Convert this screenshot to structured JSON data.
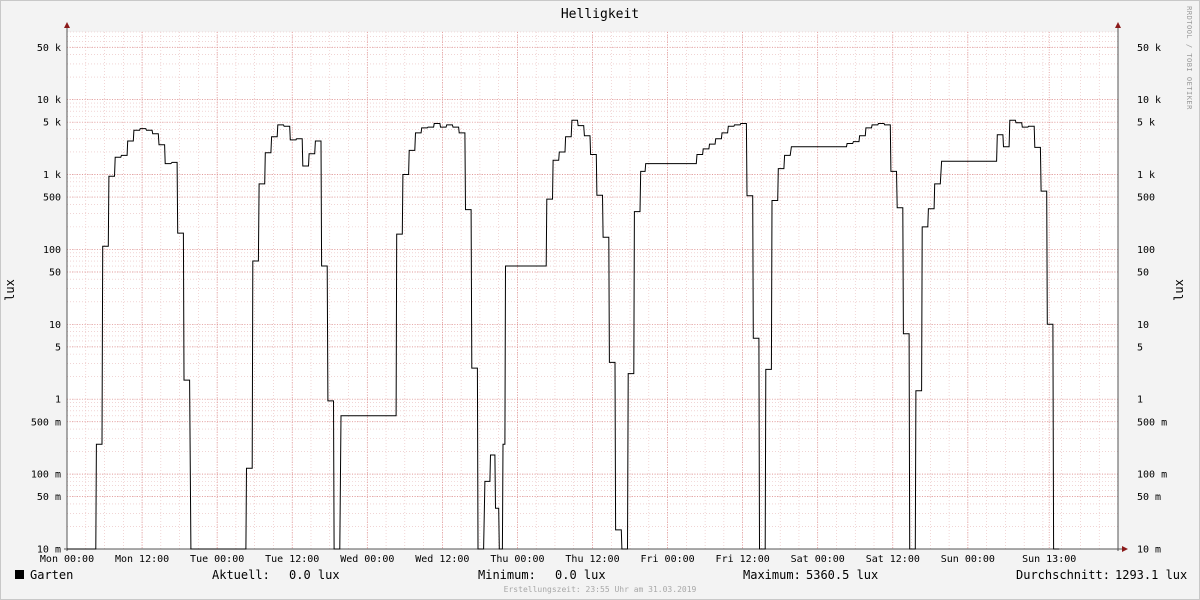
{
  "chart_data": {
    "type": "line",
    "title": "Helligkeit",
    "ylabel": "lux",
    "yscale": "log",
    "ylim": [
      0.01,
      80000
    ],
    "xlim_hours": [
      0,
      168
    ],
    "x_tick_labels": [
      "Mon 00:00",
      "Mon 12:00",
      "Tue 00:00",
      "Tue 12:00",
      "Wed 00:00",
      "Wed 12:00",
      "Thu 00:00",
      "Thu 12:00",
      "Fri 00:00",
      "Fri 12:00",
      "Sat 00:00",
      "Sat 12:00",
      "Sun 00:00",
      "Sun 13:00"
    ],
    "x_tick_hours": [
      0,
      12,
      24,
      36,
      48,
      60,
      72,
      84,
      96,
      108,
      120,
      132,
      144,
      157
    ],
    "y_tick_labels": [
      "50 k",
      "10 k",
      "5 k",
      "1 k",
      "500",
      "100",
      "50",
      "10",
      "5",
      "1",
      "500 m",
      "100 m",
      "50 m",
      "10 m"
    ],
    "y_tick_values": [
      50000,
      10000,
      5000,
      1000,
      500,
      100,
      50,
      10,
      5,
      1,
      0.5,
      0.1,
      0.05,
      0.01
    ],
    "grid": true,
    "legend_position": "bottom-left",
    "watermark": "RRDTOOL / TOBI OETIKER",
    "series": [
      {
        "name": "Garten",
        "color": "#000000",
        "x_hours": [
          0,
          4.6,
          4.7,
          5.6,
          5.7,
          6.6,
          6.7,
          7.6,
          7.7,
          8.6,
          8.7,
          9.6,
          9.7,
          10.6,
          10.7,
          11.6,
          11.7,
          12.6,
          12.7,
          13.6,
          13.7,
          14.6,
          14.7,
          15.6,
          15.7,
          16.6,
          16.8,
          17.6,
          17.7,
          18.6,
          18.7,
          19.6,
          19.8,
          28.6,
          28.7,
          29.6,
          29.7,
          30.6,
          30.7,
          31.6,
          31.7,
          32.6,
          32.7,
          33.6,
          33.7,
          34.6,
          34.7,
          35.6,
          35.7,
          36.6,
          36.7,
          37.6,
          37.7,
          38.6,
          38.7,
          39.6,
          39.7,
          40.6,
          40.7,
          41.6,
          41.7,
          42.6,
          42.7,
          43.6,
          43.8,
          52.6,
          52.7,
          53.6,
          53.7,
          54.6,
          54.7,
          55.6,
          55.7,
          56.6,
          56.7,
          57.6,
          57.7,
          58.6,
          58.7,
          59.6,
          59.7,
          60.6,
          60.7,
          61.6,
          61.7,
          62.6,
          62.7,
          63.6,
          63.7,
          64.6,
          64.7,
          65.6,
          65.7,
          66.6,
          66.8,
          67.6,
          67.7,
          68.4,
          68.5,
          69.0,
          69.1,
          69.6,
          69.7,
          70.0,
          70.1,
          76.6,
          76.7,
          77.6,
          77.7,
          78.6,
          78.7,
          79.6,
          79.7,
          80.6,
          80.7,
          81.6,
          81.7,
          82.6,
          82.7,
          83.6,
          83.7,
          84.6,
          84.7,
          85.6,
          85.7,
          86.6,
          86.7,
          87.6,
          87.7,
          88.6,
          88.7,
          89.6,
          89.7,
          90.6,
          90.7,
          91.6,
          91.7,
          92.4,
          92.5,
          100.6,
          100.7,
          101.6,
          101.7,
          102.6,
          102.7,
          103.6,
          103.7,
          104.6,
          104.7,
          105.6,
          105.7,
          106.6,
          106.7,
          107.6,
          107.7,
          108.6,
          108.7,
          109.6,
          109.7,
          110.6,
          110.7,
          111.6,
          111.7,
          112.6,
          112.7,
          113.6,
          113.7,
          114.6,
          114.7,
          115.6,
          115.8,
          124.6,
          124.7,
          125.6,
          125.7,
          126.6,
          126.7,
          127.6,
          127.7,
          128.6,
          128.7,
          129.6,
          129.7,
          130.6,
          130.7,
          131.6,
          131.7,
          132.6,
          132.7,
          133.6,
          133.7,
          134.6,
          134.7,
          135.6,
          135.7,
          136.6,
          136.7,
          137.6,
          137.7,
          138.6,
          138.7,
          139.6,
          139.8,
          148.6,
          148.7,
          149.6,
          149.7,
          150.6,
          150.7,
          151.6,
          151.7,
          152.6,
          152.7,
          153.6,
          153.7,
          154.6,
          154.7,
          155.6,
          155.7,
          156.6,
          156.7,
          157.6,
          157.7,
          158.6,
          158.7,
          159.6,
          159.7,
          160.6,
          160.7,
          161.6,
          161.7,
          162.6,
          162.7,
          163.6,
          163.8,
          168
        ],
        "y_lux": [
          0.01,
          0.01,
          0.25,
          0.25,
          110,
          110,
          950,
          950,
          1700,
          1700,
          1800,
          1800,
          2800,
          2800,
          3900,
          3900,
          4100,
          4100,
          3900,
          3900,
          3500,
          3500,
          2500,
          2500,
          1400,
          1400,
          1450,
          1450,
          165,
          165,
          1.8,
          1.8,
          0.01,
          0.01,
          0.12,
          0.12,
          70,
          70,
          750,
          750,
          1950,
          1950,
          3200,
          3200,
          4600,
          4600,
          4400,
          4400,
          2900,
          2900,
          3000,
          3000,
          1300,
          1300,
          1900,
          1900,
          2800,
          2800,
          60,
          60,
          0.95,
          0.95,
          0.01,
          0.01,
          0.6,
          0.6,
          160,
          160,
          1000,
          1000,
          2100,
          2100,
          3600,
          3600,
          4200,
          4200,
          4300,
          4300,
          4800,
          4800,
          4300,
          4300,
          4600,
          4600,
          4300,
          4300,
          3600,
          3600,
          340,
          340,
          2.6,
          2.6,
          0.01,
          0.01,
          0.08,
          0.08,
          0.18,
          0.18,
          0.035,
          0.035,
          0.01,
          0.01,
          0.25,
          0.25,
          60,
          60,
          470,
          470,
          1550,
          1550,
          2000,
          2000,
          3200,
          3200,
          5300,
          5300,
          4500,
          4500,
          3300,
          3300,
          1850,
          1850,
          530,
          530,
          145,
          145,
          3.1,
          3.1,
          0.018,
          0.018,
          0.01,
          0.01,
          2.2,
          2.2,
          320,
          320,
          1100,
          1100,
          1400,
          1400,
          1850,
          1850,
          2200,
          2200,
          2550,
          2550,
          3000,
          3000,
          3600,
          3600,
          4400,
          4400,
          4600,
          4600,
          4800,
          4800,
          520,
          520,
          6.5,
          6.5,
          0.01,
          0.01,
          2.5,
          2.5,
          450,
          450,
          1200,
          1200,
          1800,
          1800,
          2350,
          2350,
          2600,
          2600,
          2750,
          2750,
          3300,
          3300,
          4200,
          4200,
          4600,
          4600,
          4800,
          4800,
          4600,
          4600,
          1100,
          1100,
          360,
          360,
          7.5,
          7.5,
          0.01,
          0.01,
          1.3,
          1.3,
          200,
          200,
          350,
          350,
          750,
          750,
          1500,
          1500,
          3400,
          3400,
          2350,
          2350,
          5300,
          5300,
          4900,
          4900,
          4300,
          4300,
          4400,
          4400,
          2300,
          2300,
          600,
          600,
          10,
          10,
          0.01,
          0.01
        ],
        "current_label": "Aktuell:",
        "current_value": "0.0 lux",
        "min_label": "Minimum:",
        "min_value": "0.0 lux",
        "max_label": "Maximum:",
        "max_value": "5360.5 lux",
        "avg_label": "Durchschnitt:",
        "avg_value": "1293.1 lux"
      }
    ]
  },
  "footer": {
    "created": "Erstellungszeit: 23:55 Uhr am 31.03.2019"
  }
}
